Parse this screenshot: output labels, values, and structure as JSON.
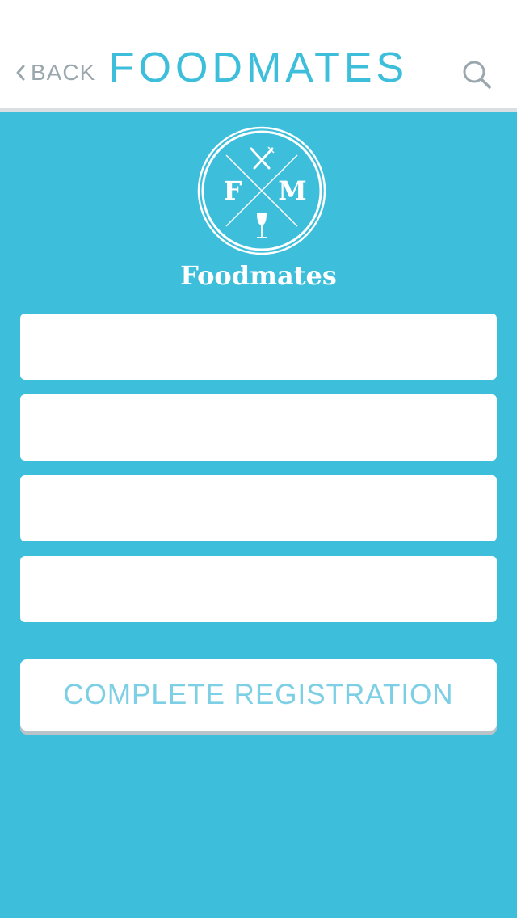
{
  "header": {
    "back_label": "BACK",
    "title": "FOODMATES"
  },
  "logo": {
    "left_letter": "F",
    "right_letter": "M",
    "name": "Foodmates"
  },
  "form": {
    "fields": [
      {
        "value": "",
        "placeholder": ""
      },
      {
        "value": "",
        "placeholder": ""
      },
      {
        "value": "",
        "placeholder": ""
      },
      {
        "value": "",
        "placeholder": ""
      }
    ],
    "submit_label": "COMPLETE REGISTRATION"
  },
  "colors": {
    "accent": "#3dbedb",
    "button_text": "#7ccfe4",
    "muted": "#9aa7ad"
  },
  "icons": [
    "chevron-left-icon",
    "search-icon",
    "fork-knife-icon",
    "wine-glass-icon"
  ]
}
